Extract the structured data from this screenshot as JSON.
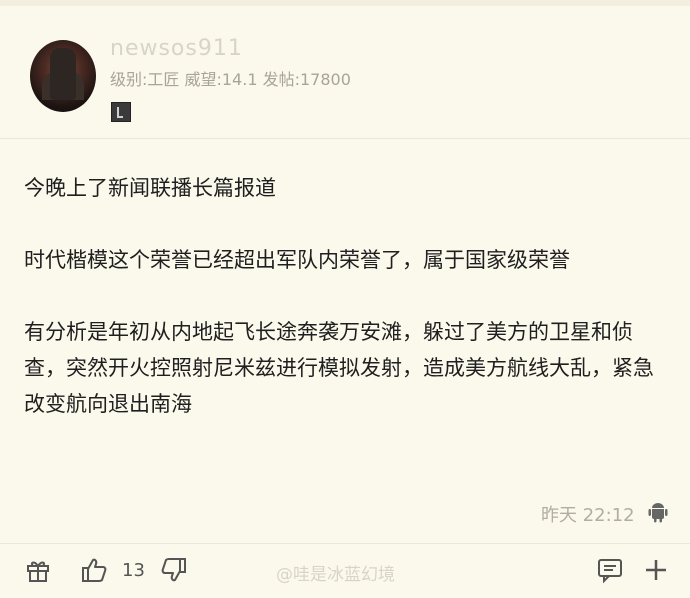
{
  "post": {
    "username": "newsos911",
    "meta": "级别:工匠 威望:14.1 发帖:17800",
    "paragraphs": [
      "今晚上了新闻联播长篇报道",
      "时代楷模这个荣誉已经超出军队内荣誉了，属于国家级荣誉",
      "有分析是年初从内地起飞长途奔袭万安滩，躲过了美方的卫星和侦查，突然开火控照射尼米兹进行模拟发射，造成美方航线大乱，紧急改变航向退出南海"
    ],
    "time": "昨天 22:12"
  },
  "footer": {
    "like_count": "13",
    "watermark": "@哇是冰蓝幻境"
  },
  "icons": {
    "gift": "gift-icon",
    "like": "thumbs-up-icon",
    "dislike": "thumbs-down-icon",
    "comment": "comment-icon",
    "add": "plus-icon",
    "android": "android-icon"
  }
}
